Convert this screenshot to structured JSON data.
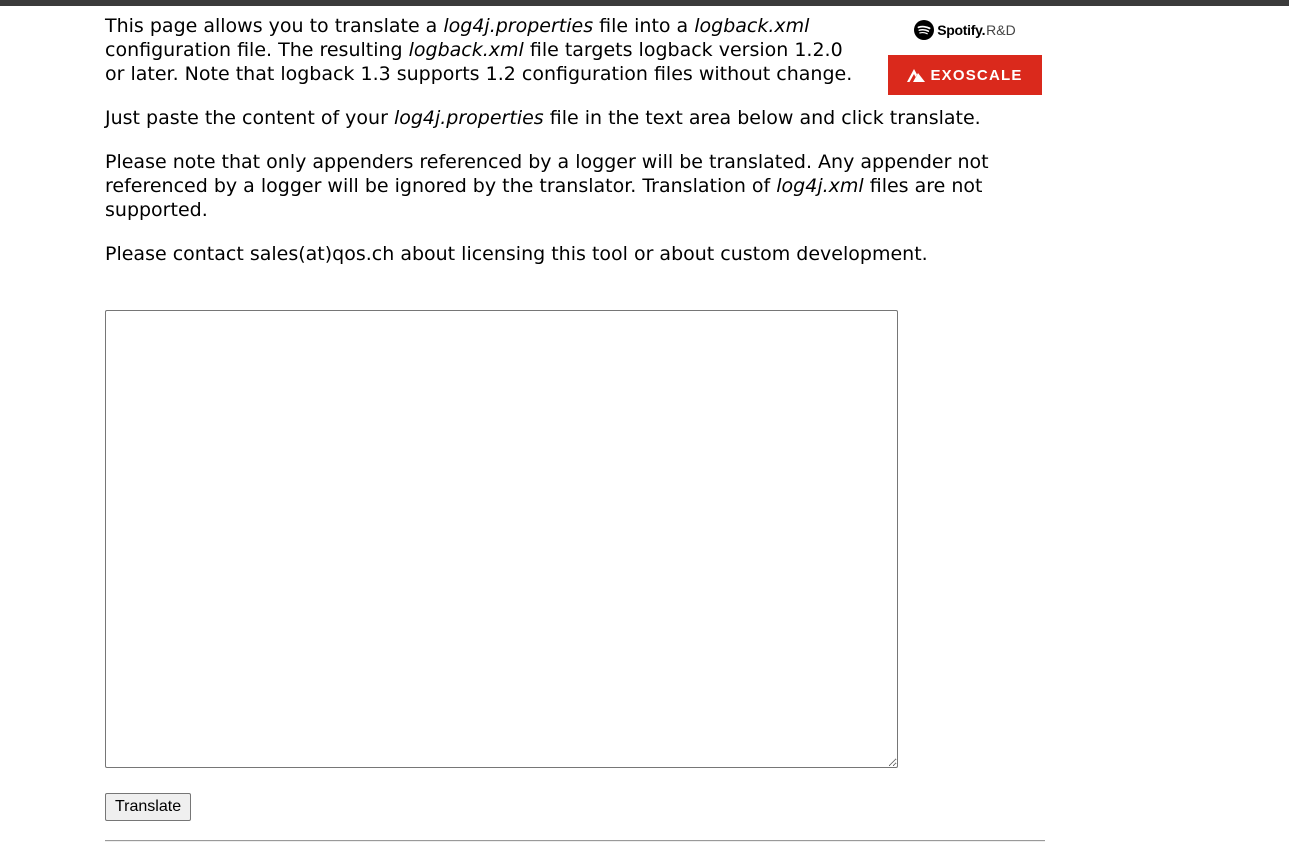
{
  "intro": {
    "part1": "This page allows you to translate a ",
    "file1": "log4j.properties",
    "part2": " file into a ",
    "file2": "logback.xml",
    "part3": " configuration file. The resulting ",
    "file3": "logback.xml",
    "part4": " file targets logback version 1.2.0 or later. Note that logback 1.3 supports 1.2 configuration files without change."
  },
  "paste_note": {
    "part1": "Just paste the content of your ",
    "file": "log4j.properties",
    "part2": " file in the text area below and click translate."
  },
  "appender_note": {
    "part1": "Please note that only appenders referenced by a logger will be translated. Any appender not referenced by a logger will be ignored by the translator. Translation of ",
    "file": "log4j.xml",
    "part2": " files are not supported."
  },
  "contact_note": "Please contact sales(at)qos.ch about licensing this tool or about custom development.",
  "sponsors": {
    "spotify_name": "Spotify.",
    "spotify_suffix": "R&D",
    "exoscale_name": "EXOSCALE"
  },
  "input": {
    "value": "",
    "placeholder": ""
  },
  "translate_button_label": "Translate",
  "colors": {
    "exoscale_red": "#da291c",
    "top_bar": "#3b3b3b"
  }
}
